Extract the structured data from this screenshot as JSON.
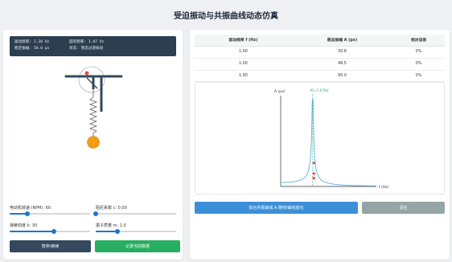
{
  "title": "受迫振动与共振曲线动态仿真",
  "info": {
    "drive_freq_label": "驱动频率:",
    "drive_freq_value": "1.30 Hz",
    "natural_freq_label": "固有频率:",
    "natural_freq_value": "1.07 Hz",
    "amplitude_label": "稳定振幅:",
    "amplitude_value": "50.0 px",
    "state_label": "状态:",
    "state_value": "暂态过渡振动"
  },
  "controls": {
    "motor_speed": {
      "label": "电动机转速 (RPM): 60",
      "fraction": 0.22
    },
    "damping": {
      "label": "阻尼系数 c: 0.00",
      "fraction": 0.0
    },
    "spring": {
      "label": "弹簧劲度 k: 30",
      "fraction": 0.55
    },
    "mass": {
      "label": "振子质量 m: 1.0",
      "fraction": 0.27
    }
  },
  "buttons": {
    "pause": "暂停/继续",
    "record": "记录当前数据",
    "plot": "拟合共振曲线 A 随f的曲线变化",
    "clear": "清空"
  },
  "table": {
    "headers": [
      "驱动频率 f (Hz)",
      "稳态振幅 A (px)",
      "相对误差"
    ],
    "rows": [
      [
        "1.00",
        "30.8",
        "0%"
      ],
      [
        "1.00",
        "46.5",
        "0%"
      ],
      [
        "1.00",
        "95.0",
        "0%"
      ]
    ]
  },
  "chart_data": {
    "type": "line",
    "xlabel": "f (Hz)",
    "ylabel": "A (px)",
    "annotation": "f0=1.07Hz",
    "resonance_freq": 1.07,
    "x_range": [
      0,
      3.2
    ],
    "y_range": [
      0,
      120
    ],
    "gamma": 0.02,
    "scale": 6,
    "points": [
      {
        "x": 1.07,
        "y": 31
      },
      {
        "x": 1.07,
        "y": 17
      },
      {
        "x": 1.07,
        "y": 11
      }
    ],
    "colors": {
      "curve": "#5dade2",
      "marker": "#27ae60",
      "point": "#e74c3c"
    }
  },
  "colors": {
    "accent": "#1976d2",
    "dark": "#2c3e50",
    "success": "#27ae60",
    "muted": "#95a5a6",
    "mass": "#f39c12"
  }
}
